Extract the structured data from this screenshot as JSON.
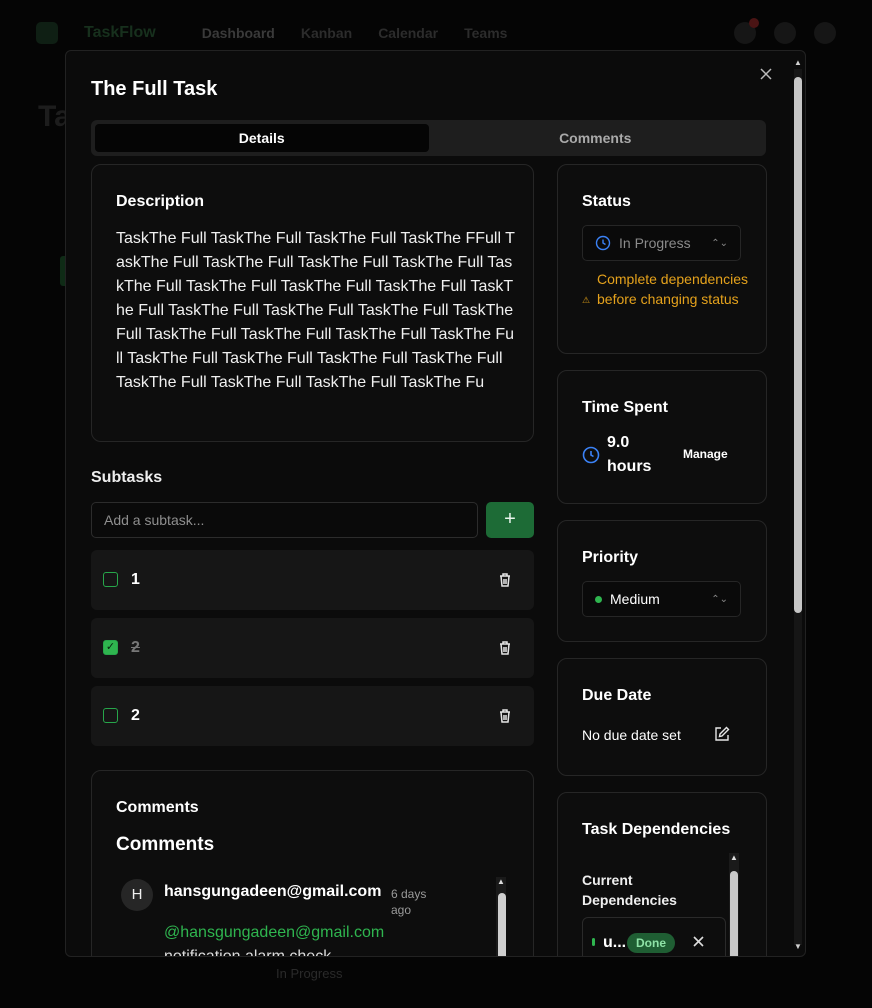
{
  "background": {
    "brand": "TaskFlow",
    "nav": [
      "Dashboard",
      "Kanban",
      "Calendar",
      "Teams"
    ],
    "title": "Ta",
    "bottom_status": "In Progress"
  },
  "modal": {
    "title": "The Full Task",
    "tabs": [
      {
        "label": "Details",
        "active": true
      },
      {
        "label": "Comments",
        "active": false
      }
    ],
    "description": {
      "heading": "Description",
      "text": "TaskThe Full TaskThe Full TaskThe Full TaskThe FFull TaskThe Full TaskThe Full TaskThe Full TaskThe Full TaskThe Full TaskThe Full TaskThe Full TaskThe Full TaskThe Full TaskThe Full TaskThe Full TaskThe Full TaskThe Full TaskThe Full TaskThe Full TaskThe Full TaskThe Full TaskThe Full TaskThe Full TaskThe Full TaskThe Full TaskThe Full TaskThe Full TaskThe Full TaskThe Fu"
    },
    "subtasks": {
      "heading": "Subtasks",
      "input_placeholder": "Add a subtask...",
      "add_label": "+",
      "items": [
        {
          "label": "1",
          "done": false
        },
        {
          "label": "2",
          "done": true
        },
        {
          "label": "2",
          "done": false
        }
      ]
    },
    "comments": {
      "heading": "Comments",
      "subheading": "Comments",
      "items": [
        {
          "avatar": "H",
          "author": "hansgungadeen@gmail.com",
          "time": "6 days ago",
          "mention": "@hansgungadeen@gmail.com",
          "body": "notification alarm check"
        }
      ]
    },
    "status": {
      "heading": "Status",
      "value": "In Progress",
      "warning": "Complete dependencies before changing status"
    },
    "time_spent": {
      "heading": "Time Spent",
      "value": "9.0 hours",
      "manage_label": "Manage"
    },
    "priority": {
      "heading": "Priority",
      "value": "Medium"
    },
    "due_date": {
      "heading": "Due Date",
      "value": "No due date set"
    },
    "dependencies": {
      "heading": "Task Dependencies",
      "subheading": "Current Dependencies",
      "items": [
        {
          "name": "u...",
          "status": "Done"
        }
      ]
    }
  },
  "colors": {
    "accent_green": "#2fb54f",
    "warning": "#e5a21c",
    "clock_blue": "#3b82f6"
  }
}
